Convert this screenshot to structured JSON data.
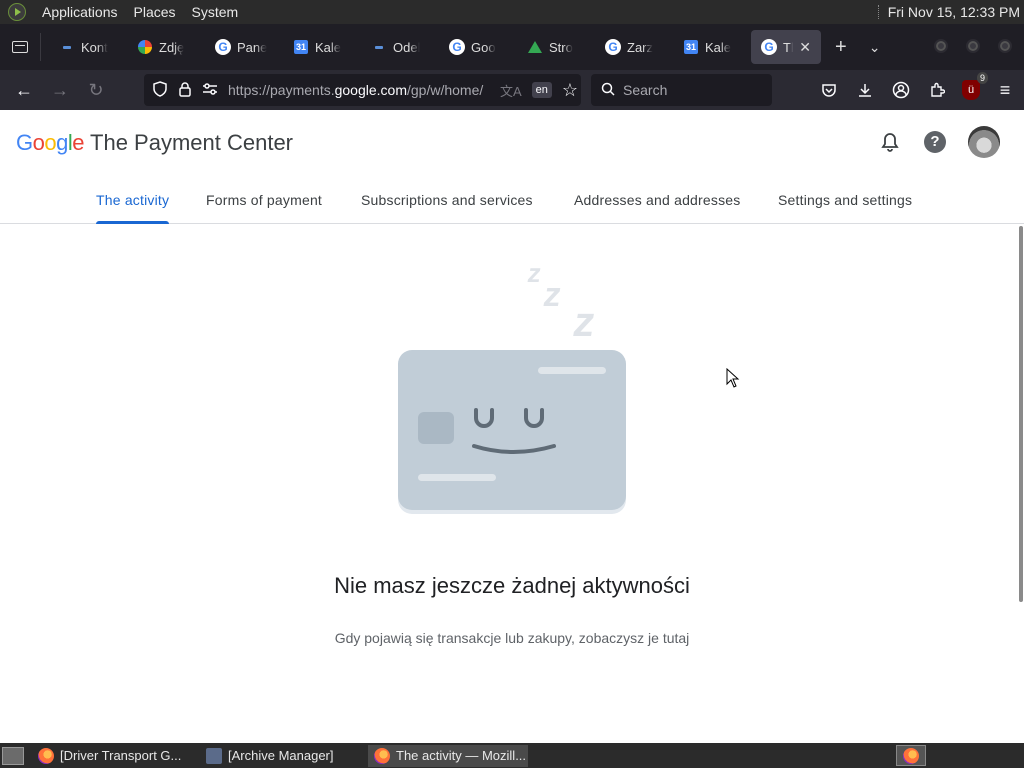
{
  "top_panel": {
    "menus": [
      "Applications",
      "Places",
      "System"
    ],
    "clock": "Fri Nov 15, 12:33 PM"
  },
  "browser": {
    "tabs": [
      {
        "label": "Kont",
        "icon": "dash-icon"
      },
      {
        "label": "Zdję",
        "icon": "google-photos-icon"
      },
      {
        "label": "Pane",
        "icon": "google-icon"
      },
      {
        "label": "Kale",
        "icon": "calendar-icon"
      },
      {
        "label": "Odel",
        "icon": "dash-icon"
      },
      {
        "label": "Goo",
        "icon": "google-icon"
      },
      {
        "label": "Stro",
        "icon": "google-drive-icon"
      },
      {
        "label": "Zarz",
        "icon": "google-icon"
      },
      {
        "label": "Kale",
        "icon": "calendar-icon"
      },
      {
        "label": "Th",
        "icon": "google-icon",
        "active": true
      }
    ],
    "url_prefix": "https://payments.",
    "url_domain": "google.com",
    "url_suffix": "/gp/w/home/",
    "lang_badge": "en",
    "search_placeholder": "Search",
    "extension_badge_count": "9"
  },
  "page": {
    "logo_text": "Google",
    "product_name": "The Payment Center",
    "tabs": [
      {
        "label": "The activity",
        "active": true
      },
      {
        "label": "Forms of payment"
      },
      {
        "label": "Subscriptions and services"
      },
      {
        "label": "Addresses and addresses"
      },
      {
        "label": "Settings and settings"
      }
    ],
    "empty_state": {
      "title": "Nie masz jeszcze żadnej aktywności",
      "subtitle": "Gdy pojawią się transakcje lub zakupy, zobaczysz je tutaj"
    }
  },
  "taskbar": {
    "tasks": [
      {
        "label": "[Driver Transport G...",
        "icon": "firefox-icon"
      },
      {
        "label": "[Archive Manager]",
        "icon": "archive-manager-icon"
      },
      {
        "label": "The activity — Mozill...",
        "icon": "firefox-icon",
        "active": true
      }
    ]
  },
  "colors": {
    "accent": "#1967d2",
    "browser_chrome": "#2b2a33",
    "tabbar": "#1f1e25",
    "panel": "#2b2b2b"
  }
}
